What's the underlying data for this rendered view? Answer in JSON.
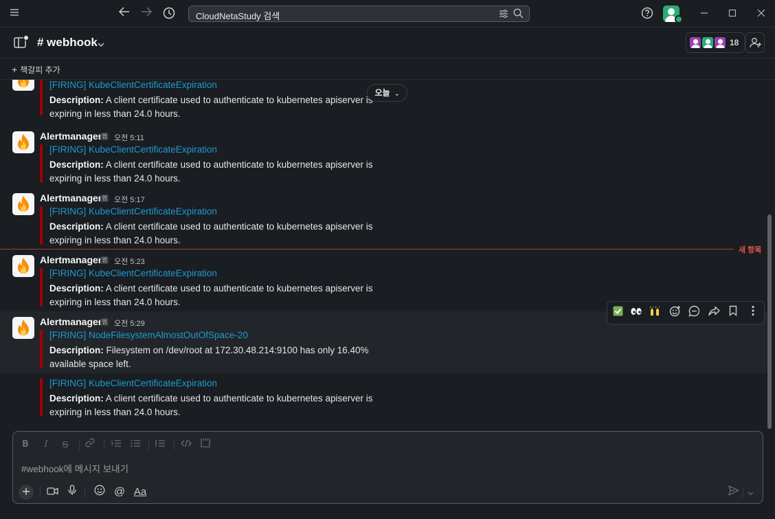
{
  "search": {
    "placeholder": "CloudNetaStudy 검색"
  },
  "channel": {
    "name": "# webhook",
    "member_count": "18"
  },
  "bookmarks": {
    "add_label": "책갈피 추가"
  },
  "date_divider": {
    "label": "오늘"
  },
  "new_divider": {
    "label": "새 항목"
  },
  "app_badge": "앱",
  "messages": [
    {
      "sender": "",
      "time": "",
      "title": "[FIRING] KubeClientCertificateExpiration",
      "desc_label": "Description:",
      "desc_text": " A client certificate used to authenticate to kubernetes apiserver is expiring in less than 24.0 hours."
    },
    {
      "sender": "Alertmanager",
      "time": "오전 5:11",
      "title": "[FIRING] KubeClientCertificateExpiration",
      "desc_label": "Description:",
      "desc_text": " A client certificate used to authenticate to kubernetes apiserver is expiring in less than 24.0 hours."
    },
    {
      "sender": "Alertmanager",
      "time": "오전 5:17",
      "title": "[FIRING] KubeClientCertificateExpiration",
      "desc_label": "Description:",
      "desc_text": " A client certificate used to authenticate to kubernetes apiserver is expiring in less than 24.0 hours."
    },
    {
      "sender": "Alertmanager",
      "time": "오전 5:23",
      "title": "[FIRING] KubeClientCertificateExpiration",
      "desc_label": "Description:",
      "desc_text": " A client certificate used to authenticate to kubernetes apiserver is expiring in less than 24.0 hours."
    },
    {
      "sender": "Alertmanager",
      "time": "오전 5:29",
      "title": "[FIRING] NodeFilesystemAlmostOutOfSpace-20",
      "desc_label": "Description:",
      "desc_text": " Filesystem on /dev/root at 172.30.48.214:9100 has only 16.40% available space left."
    },
    {
      "sender": "",
      "time": "",
      "title": "[FIRING] KubeClientCertificateExpiration",
      "desc_label": "Description:",
      "desc_text": " A client certificate used to authenticate to kubernetes apiserver is expiring in less than 24.0 hours."
    }
  ],
  "composer": {
    "placeholder": "#webhook에 메시지 보내기"
  },
  "colors": {
    "attachment_bar": "#a30200",
    "link": "#1d9bd1",
    "new_line": "#b2402a"
  }
}
